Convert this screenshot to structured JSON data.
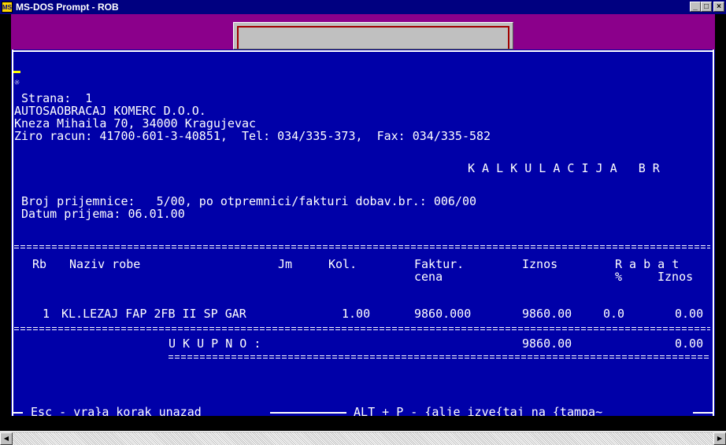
{
  "window": {
    "title": "MS-DOS Prompt - ROB",
    "icon_label": "MS",
    "buttons": {
      "minimize": "_",
      "maximize": "□",
      "close": "×"
    }
  },
  "console": {
    "star": "☼",
    "page_line": " Strana:  1",
    "company": "AUTOSAOBRACAJ KOMERC D.O.O.",
    "address": "Kneza Mihaila 70, 34000 Kragujevac",
    "bank_line": "Ziro racun: 41700-601-3-40851,  Tel: 034/335-373,  Fax: 034/335-582",
    "doc_title": "K A L K U L A C I J A   B R",
    "receipt_line": " Broj prijemnice:   5/00, po otpremnici/fakturi dobav.br.: 006/00",
    "date_line": " Datum prijema: 06.01.00",
    "headers": {
      "rb": "Rb",
      "naziv": "Naziv robe",
      "jm": "Jm",
      "kol": "Kol.",
      "faktur_1": "Faktur.",
      "faktur_2": "cena",
      "iznos": "Iznos",
      "rabat_1": "R a b a t",
      "rabat_pct": "%",
      "rabat_iznos": "Iznos"
    },
    "rows": [
      {
        "rb": "1",
        "naziv": "KL.LEZAJ FAP 2FB II SP GAR",
        "kol": "1.00",
        "cena": "9860.000",
        "iznos": "9860.00",
        "rabat_pct": "0.0",
        "rabat_iznos": "0.00"
      }
    ],
    "total_label": "U K U P N O :",
    "total_iznos": "9860.00",
    "total_rabat": "0.00",
    "footer_esc": " Esc - vra}a korak unazad ",
    "footer_alt": " ALT + P - {alje izve{taj na {tampa~ "
  },
  "colors": {
    "console_bg": "#0000a8",
    "desktop_bg": "#8b008b",
    "titlebar": "#000080",
    "cursor": "#ffff00"
  },
  "icons": [
    "ms-dos-app-icon",
    "minimize-icon",
    "maximize-icon",
    "close-icon",
    "scroll-left-icon",
    "scroll-right-icon"
  ]
}
